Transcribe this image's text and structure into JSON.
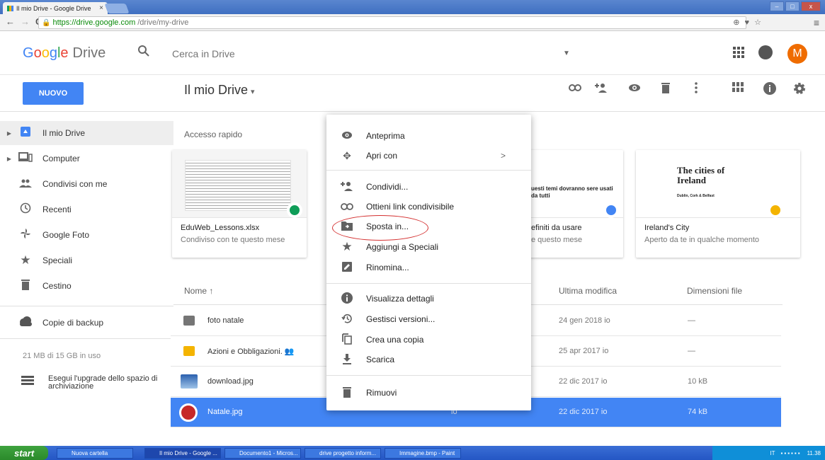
{
  "browser": {
    "tab_title": "Il mio Drive - Google Drive",
    "tab_close": "×",
    "url_host": "https://drive.google.com",
    "url_path": "/drive/my-drive",
    "back": "←",
    "forward": "→",
    "reload": "C",
    "right_icons": "⊕ ♥ ☆",
    "menu": "≡",
    "window_buttons": [
      "–",
      "□",
      "x"
    ]
  },
  "header": {
    "logo_letters": [
      "G",
      "o",
      "o",
      "g",
      "l",
      "e"
    ],
    "logo_product": "Drive",
    "search_placeholder": "Cerca in Drive",
    "avatar_letter": "M"
  },
  "toolbar": {
    "new_button": "NUOVO",
    "breadcrumb": "Il mio Drive",
    "breadcrumb_caret": "▾"
  },
  "sidebar": {
    "items": [
      {
        "label": "Il mio Drive",
        "icon": "drive-icon"
      },
      {
        "label": "Computer",
        "icon": "computer-icon"
      },
      {
        "label": "Condivisi con me",
        "icon": "people-icon"
      },
      {
        "label": "Recenti",
        "icon": "clock-icon"
      },
      {
        "label": "Google Foto",
        "icon": "pinwheel-icon"
      },
      {
        "label": "Speciali",
        "icon": "star-icon"
      },
      {
        "label": "Cestino",
        "icon": "trash-icon"
      },
      {
        "label": "Copie di backup",
        "icon": "cloud-icon"
      }
    ],
    "storage": "21 MB di 15 GB in uso",
    "upgrade": "Esegui l'upgrade dello spazio di archiviazione"
  },
  "quick_access": {
    "label": "Accesso rapido",
    "cards": [
      {
        "name": "EduWeb_Lessons.xlsx",
        "sub": "Condiviso con te questo mese"
      },
      {
        "name": "efiniti da usare",
        "sub": "e questo mese",
        "preview": "uesti temi dovranno sere usati da tutti"
      },
      {
        "name": "Ireland's City",
        "sub": "Aperto da te in qualche momento",
        "preview_title": "The cities of Ireland",
        "preview_sub": "Dublin, Cork & Belfast"
      }
    ]
  },
  "list": {
    "headers": {
      "name": "Nome",
      "sort_arrow": "↑",
      "modified": "Ultima modifica",
      "size": "Dimensioni file"
    },
    "rows": [
      {
        "name": "foto natale",
        "owner": "",
        "modified": "24 gen 2018 io",
        "size": "—",
        "type": "folder"
      },
      {
        "name": "Azioni e Obbligazioni.",
        "owner": "",
        "modified": "25 apr 2017 io",
        "size": "—",
        "type": "slides"
      },
      {
        "name": "download.jpg",
        "owner": "",
        "modified": "22 dic 2017 io",
        "size": "10 kB",
        "type": "image"
      },
      {
        "name": "Natale.jpg",
        "owner": "io",
        "modified": "22 dic 2017 io",
        "size": "74 kB",
        "type": "image"
      }
    ]
  },
  "context_menu": {
    "items": [
      {
        "label": "Anteprima",
        "icon": "eye-icon"
      },
      {
        "label": "Apri con",
        "icon": "move-arrows-icon",
        "submenu": ">"
      },
      {
        "label": "Condividi...",
        "icon": "add-person-icon"
      },
      {
        "label": "Ottieni link condivisibile",
        "icon": "link-icon"
      },
      {
        "label": "Sposta in...",
        "icon": "folder-move-icon"
      },
      {
        "label": "Aggiungi a Speciali",
        "icon": "star-icon"
      },
      {
        "label": "Rinomina...",
        "icon": "pencil-icon"
      },
      {
        "label": "Visualizza dettagli",
        "icon": "info-icon"
      },
      {
        "label": "Gestisci versioni...",
        "icon": "history-icon"
      },
      {
        "label": "Crea una copia",
        "icon": "copy-icon"
      },
      {
        "label": "Scarica",
        "icon": "download-icon"
      },
      {
        "label": "Rimuovi",
        "icon": "trash-icon"
      }
    ]
  },
  "taskbar": {
    "start": "start",
    "buttons": [
      "Nuova cartella",
      "Il mio Drive - Google ...",
      "Documento1 - Micros...",
      "drive progetto inform...",
      "Immagine.bmp - Paint"
    ],
    "lang": "IT",
    "clock": "11.38"
  },
  "colors": {
    "accent": "#4285f4",
    "avatar": "#ef6c00",
    "highlight_ring": "#d43030"
  }
}
